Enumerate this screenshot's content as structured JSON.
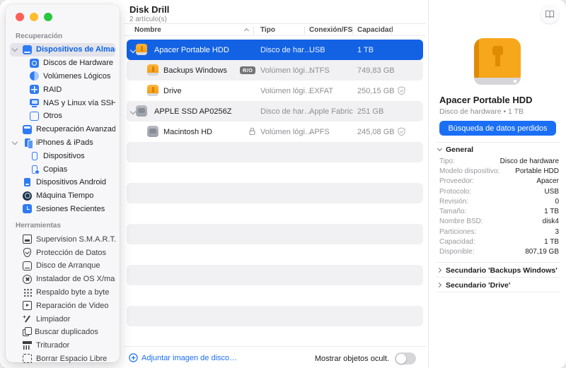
{
  "colors": {
    "accent_blue": "#1A6FF5",
    "selected_row_blue": "#1362E4",
    "sidebar_selected_text": "#0B63E5",
    "drive_orange": "#F6A41E",
    "zebra_gray": "#F1F1F3",
    "traffic_red": "#FF5F57",
    "traffic_yellow": "#FEBC2E",
    "traffic_green": "#28C840"
  },
  "sidebar": {
    "sections": [
      {
        "label": "Recuperación",
        "items": [
          {
            "label": "Dispositivos de Almacenaje"
          },
          {
            "label": "Discos de Hardware"
          },
          {
            "label": "Volúmenes Lógicos"
          },
          {
            "label": "RAID"
          },
          {
            "label": "NAS y Linux vía SSH"
          },
          {
            "label": "Otros"
          },
          {
            "label": "Recuperación Avanzada d…"
          },
          {
            "label": "iPhones & iPads"
          },
          {
            "label": "Dispositivos"
          },
          {
            "label": "Copias"
          },
          {
            "label": "Dispositivos Android"
          },
          {
            "label": "Máquina Tiempo"
          },
          {
            "label": "Sesiones Recientes"
          }
        ]
      },
      {
        "label": "Herramientas",
        "items": [
          {
            "label": "Supervision S.M.A.R.T."
          },
          {
            "label": "Protección de Datos"
          },
          {
            "label": "Disco de Arranque"
          },
          {
            "label": "Instalador de OS X/macOS"
          },
          {
            "label": "Respaldo byte a byte"
          },
          {
            "label": "Reparación de Video"
          },
          {
            "label": "Limpiador"
          },
          {
            "label": "Buscar duplicados"
          },
          {
            "label": "Triturador"
          },
          {
            "label": "Borrar Espacio Libre"
          }
        ]
      }
    ]
  },
  "main": {
    "title": "Disk Drill",
    "subtitle": "2 artículo(s)",
    "columns": [
      "Nombre",
      "Tipo",
      "Conexión/FS",
      "Capacidad"
    ],
    "rows": [
      {
        "name": "Apacer Portable HDD",
        "type": "Disco de har…",
        "fs": "USB",
        "capacity": "1 TB"
      },
      {
        "name": "Backups Windows",
        "badge": "R/O",
        "type": "Volúmen lógi…",
        "fs": "NTFS",
        "capacity": "749,83 GB"
      },
      {
        "name": "Drive",
        "type": "Volúmen lógi…",
        "fs": "EXFAT",
        "capacity": "250,15 GB"
      },
      {
        "name": "APPLE SSD AP0256Z",
        "type": "Disco de har…",
        "fs": "Apple Fabric",
        "capacity": "251 GB"
      },
      {
        "name": "Macintosh HD",
        "type": "Volúmen lógi…",
        "fs": "APFS",
        "capacity": "245,08 GB"
      }
    ],
    "footer": {
      "attach_label": "Adjuntar imagen de disco…",
      "show_hidden_label": "Mostrar objetos ocult."
    }
  },
  "details": {
    "title": "Apacer Portable HDD",
    "subtitle": "Disco de hardware • 1 TB",
    "action_label": "Búsqueda de datos perdidos",
    "general": {
      "label": "General",
      "rows": [
        {
          "label": "Tipo:",
          "value": "Disco de hardware"
        },
        {
          "label": "Modelo dispositivo:",
          "value": "Portable HDD"
        },
        {
          "label": "Proveedor:",
          "value": "Apacer"
        },
        {
          "label": "Protocolo:",
          "value": "USB"
        },
        {
          "label": "Revisión:",
          "value": "0"
        },
        {
          "label": "Tamaño:",
          "value": "1 TB"
        },
        {
          "label": "Nombre BSD:",
          "value": "disk4"
        },
        {
          "label": "Particiones:",
          "value": "3"
        },
        {
          "label": "Capacidad:",
          "value": "1 TB"
        },
        {
          "label": "Disponible:",
          "value": "807,19 GB"
        }
      ]
    },
    "sections": [
      {
        "label": "Secundario 'Backups Windows'"
      },
      {
        "label": "Secundario 'Drive'"
      }
    ]
  }
}
